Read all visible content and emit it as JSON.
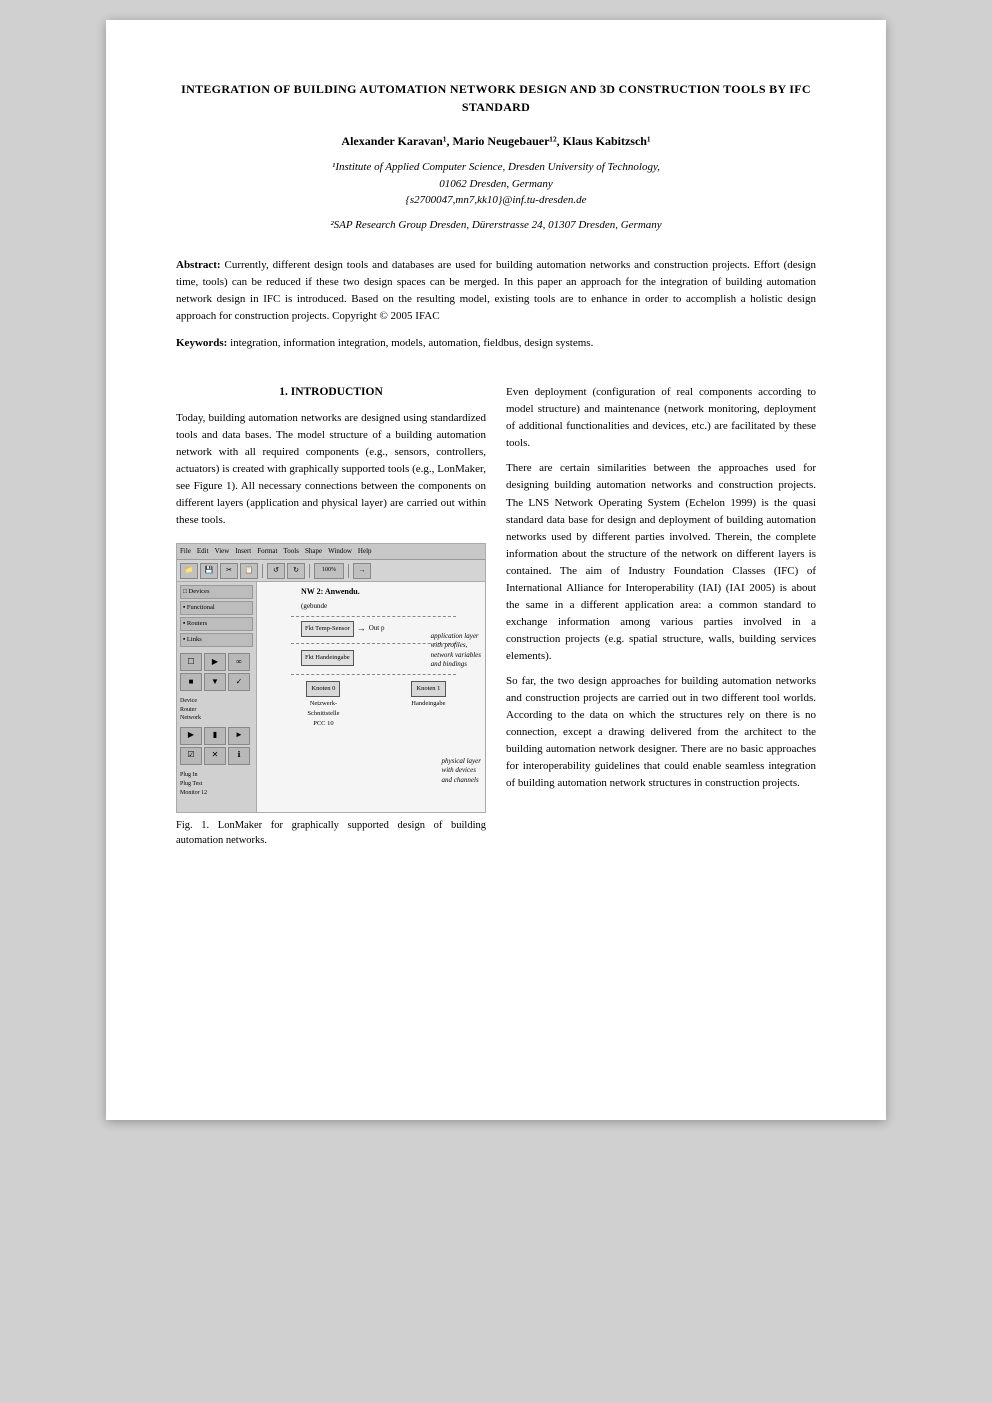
{
  "page": {
    "title": "INTEGRATION OF BUILDING AUTOMATION NETWORK DESIGN AND 3D CONSTRUCTION TOOLS BY IFC STANDARD",
    "authors": "Alexander Karavan¹, Mario Neugebauer¹², Klaus Kabitzsch¹",
    "affiliation1_line1": "¹Institute of Applied Computer Science, Dresden University of Technology,",
    "affiliation1_line2": "01062 Dresden, Germany",
    "affiliation1_line3": "{s2700047,mn7,kk10}@inf.tu-dresden.de",
    "affiliation2": "²SAP Research Group Dresden, Dürerstrasse 24, 01307 Dresden, Germany",
    "abstract_label": "Abstract:",
    "abstract_text": "Currently, different design tools and databases are used for building automation networks and construction projects. Effort (design time, tools) can be reduced if these two design spaces can be merged. In this paper an approach for the integration of building automation network design in IFC is introduced. Based on the resulting model, existing tools are to enhance in order to accomplish a holistic design approach for construction projects. Copyright © 2005 IFAC",
    "keywords_label": "Keywords:",
    "keywords_text": "integration, information integration, models, automation, fieldbus, design systems.",
    "section1_title": "1. INTRODUCTION",
    "section1_col1_p1": "Today, building automation networks are designed using standardized tools and data bases. The model structure of a building automation network with all required components (e.g., sensors, controllers, actuators) is created with graphically supported tools (e.g., LonMaker, see Figure 1). All necessary connections between the components on different layers (application and physical layer) are carried out within these tools.",
    "figure1_caption": "Fig. 1. LonMaker for graphically supported design of building automation networks.",
    "lm_toolbar_items": [
      "File",
      "Edit",
      "View",
      "Insert",
      "Format",
      "Tools",
      "Shape",
      "Window",
      "Help"
    ],
    "lm_nw_label": "NW 2: Anwendu.",
    "lm_nw_sublabel": "(gebunde",
    "lm_sensor_label": "Fkt Temp-Sensor",
    "lm_output_label": "Out p",
    "lm_device_label": "Fkt Handeingabe",
    "lm_knoten0": "Knoten 0",
    "lm_knoten1": "Knoten 1",
    "lm_netzwerk": "Netzwerk-\nSchnittstelle\nPCC 10",
    "lm_handeingabe": "Handeingabe",
    "lm_annotation1_top": "application layer",
    "lm_annotation1_mid": "with profiles,",
    "lm_annotation1_mid2": "network variables",
    "lm_annotation1_bot": "and bindings",
    "lm_annotation2_top": "physical layer",
    "lm_annotation2_mid": "with devices",
    "lm_annotation2_bot": "and channels",
    "col2_p1": "Even deployment (configuration of real components according to model structure) and maintenance (network monitoring, deployment of additional functionalities and devices, etc.) are facilitated by these tools.",
    "col2_p2": "There are certain similarities between the approaches used for designing building automation networks and construction projects. The LNS Network Operating System (Echelon 1999) is the quasi standard data base for design and deployment of building automation networks used by different parties involved. Therein, the complete information about the structure of the network on different layers is contained. The aim of Industry Foundation Classes (IFC) of International Alliance for Interoperability (IAI) (IAI 2005) is about the same in a different application area: a common standard to exchange information among various parties involved in a construction projects (e.g. spatial structure, walls, building services elements).",
    "col2_p3": "So far, the two design approaches for building automation networks and construction projects are carried out in two different tool worlds. According to the data on which the structures rely on there is no connection, except a drawing delivered from the architect to the building automation network designer. There are no basic approaches for interoperability guidelines that could enable seamless integration of building automation network structures in construction projects."
  }
}
